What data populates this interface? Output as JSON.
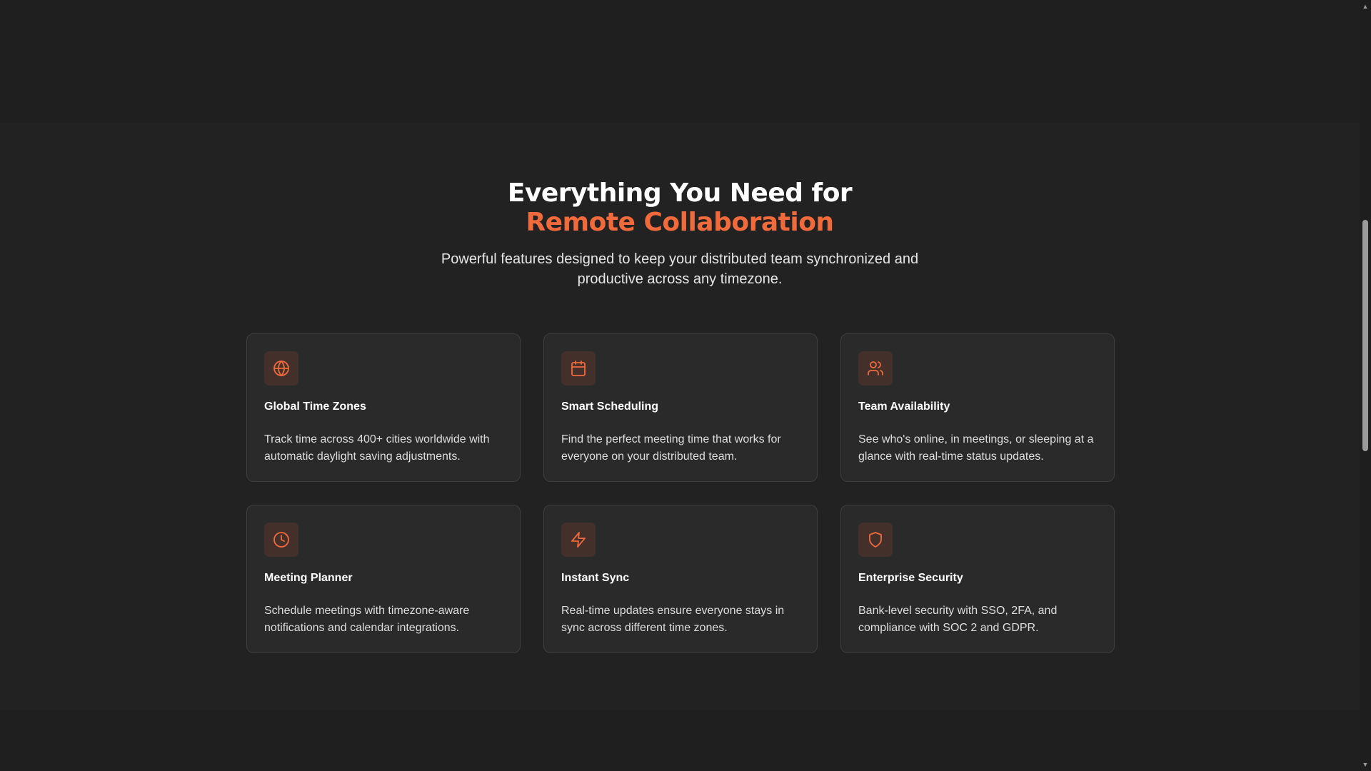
{
  "section": {
    "heading_line1": "Everything You Need for",
    "heading_line2": "Remote Collaboration",
    "subtitle": "Powerful features designed to keep your distributed team synchronized and productive across any timezone."
  },
  "colors": {
    "background": "#1f1f1f",
    "section_background": "#222222",
    "card_background": "#2a2a2a",
    "accent": "#f06a3c"
  },
  "features": [
    {
      "icon": "globe-icon",
      "title": "Global Time Zones",
      "description": "Track time across 400+ cities worldwide with automatic daylight saving adjustments."
    },
    {
      "icon": "calendar-icon",
      "title": "Smart Scheduling",
      "description": "Find the perfect meeting time that works for everyone on your distributed team."
    },
    {
      "icon": "users-icon",
      "title": "Team Availability",
      "description": "See who's online, in meetings, or sleeping at a glance with real-time status updates."
    },
    {
      "icon": "clock-icon",
      "title": "Meeting Planner",
      "description": "Schedule meetings with timezone-aware notifications and calendar integrations."
    },
    {
      "icon": "lightning-icon",
      "title": "Instant Sync",
      "description": "Real-time updates ensure everyone stays in sync across different time zones."
    },
    {
      "icon": "shield-icon",
      "title": "Enterprise Security",
      "description": "Bank-level security with SSO, 2FA, and compliance with SOC 2 and GDPR."
    }
  ]
}
